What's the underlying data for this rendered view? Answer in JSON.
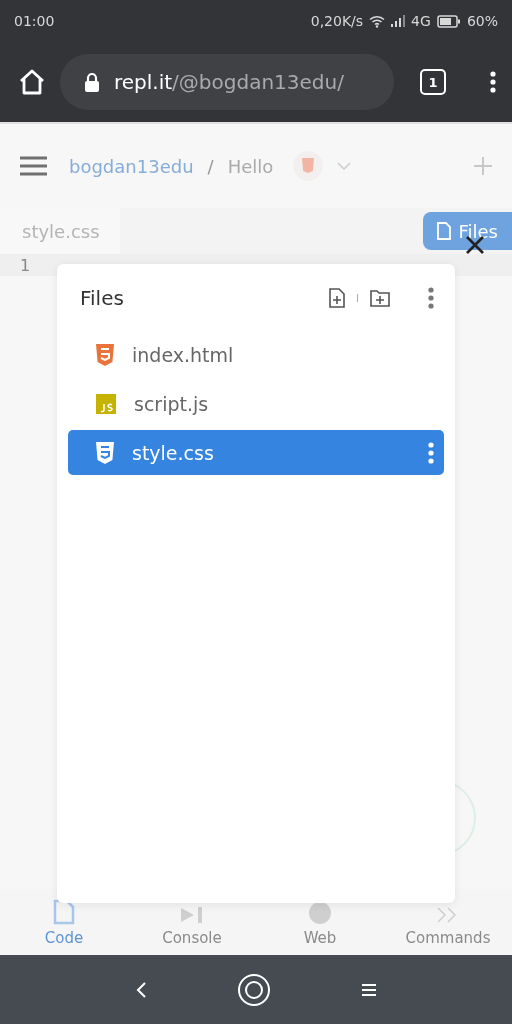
{
  "status_bar": {
    "time": "01:00",
    "speed": "0,20K/s",
    "network": "4G",
    "battery": "60%"
  },
  "browser": {
    "url_host": "repl.it",
    "url_path": "/@bogdan13edu/",
    "tab_count": "1"
  },
  "header": {
    "user": "bogdan13edu",
    "separator": "/",
    "repl": "Hello"
  },
  "editor": {
    "tab": "style.css",
    "files_button": "Files",
    "line_numbers": [
      "1"
    ]
  },
  "files_panel": {
    "title": "Files",
    "files": [
      {
        "name": "index.html",
        "kind": "html",
        "selected": false
      },
      {
        "name": "script.js",
        "kind": "js",
        "selected": false
      },
      {
        "name": "style.css",
        "kind": "css",
        "selected": true
      }
    ]
  },
  "bottom_nav": [
    {
      "label": "Code",
      "kind": "code",
      "selected": true
    },
    {
      "label": "Console",
      "kind": "console",
      "selected": false
    },
    {
      "label": "Web",
      "kind": "web",
      "selected": false
    },
    {
      "label": "Commands",
      "kind": "commands",
      "selected": false
    }
  ]
}
